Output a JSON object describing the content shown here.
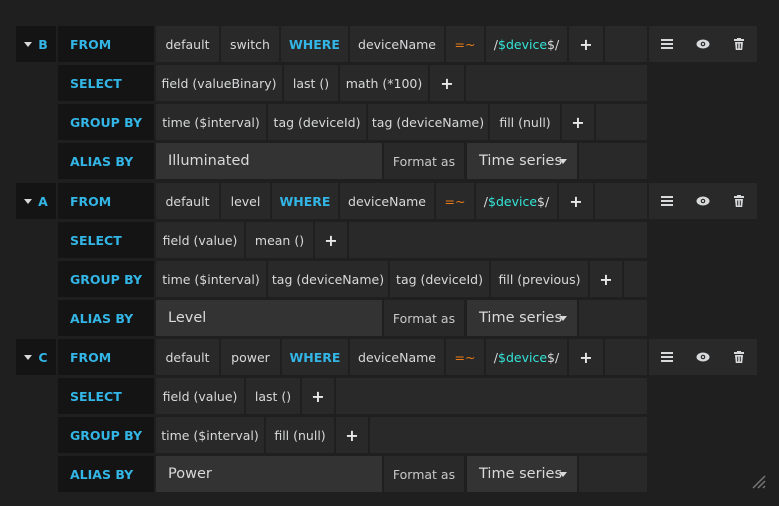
{
  "queries": [
    {
      "ref_id": "B",
      "from": {
        "keyword": "FROM",
        "policy": "default",
        "measurement": "switch",
        "where": "WHERE",
        "tag_key": "deviceName",
        "operator": "=~",
        "value_prefix": "/",
        "value_var": "$device",
        "value_suffix": "$/"
      },
      "select": {
        "keyword": "SELECT",
        "parts": [
          "field (valueBinary)",
          "last ()",
          "math (*100)"
        ]
      },
      "group_by": {
        "keyword": "GROUP BY",
        "parts": [
          "time ($interval)",
          "tag (deviceId)",
          "tag (deviceName)",
          "fill (null)"
        ]
      },
      "alias_by": {
        "keyword": "ALIAS BY",
        "value": "Illuminated",
        "format_label": "Format as",
        "format_value": "Time series"
      }
    },
    {
      "ref_id": "A",
      "from": {
        "keyword": "FROM",
        "policy": "default",
        "measurement": "level",
        "where": "WHERE",
        "tag_key": "deviceName",
        "operator": "=~",
        "value_prefix": "/",
        "value_var": "$device",
        "value_suffix": "$/"
      },
      "select": {
        "keyword": "SELECT",
        "parts": [
          "field (value)",
          "mean ()"
        ]
      },
      "group_by": {
        "keyword": "GROUP BY",
        "parts": [
          "time ($interval)",
          "tag (deviceName)",
          "tag (deviceId)",
          "fill (previous)"
        ]
      },
      "alias_by": {
        "keyword": "ALIAS BY",
        "value": "Level",
        "format_label": "Format as",
        "format_value": "Time series"
      }
    },
    {
      "ref_id": "C",
      "from": {
        "keyword": "FROM",
        "policy": "default",
        "measurement": "power",
        "where": "WHERE",
        "tag_key": "deviceName",
        "operator": "=~",
        "value_prefix": "/",
        "value_var": "$device",
        "value_suffix": "$/"
      },
      "select": {
        "keyword": "SELECT",
        "parts": [
          "field (value)",
          "last ()"
        ]
      },
      "group_by": {
        "keyword": "GROUP BY",
        "parts": [
          "time ($interval)",
          "fill (null)"
        ]
      },
      "alias_by": {
        "keyword": "ALIAS BY",
        "value": "Power",
        "format_label": "Format as",
        "format_value": "Time series"
      }
    }
  ],
  "icons": {
    "add": "plus-icon",
    "menu": "hamburger-icon",
    "toggle": "eye-icon",
    "remove": "trash-icon",
    "collapse": "caret-down-icon",
    "resize": "resize-handle-icon"
  },
  "colors": {
    "keyword": "#33b5e5",
    "operator": "#eb7b18",
    "variable": "#33e5d8",
    "segment": "#292929",
    "keyword_bg": "#141414"
  }
}
